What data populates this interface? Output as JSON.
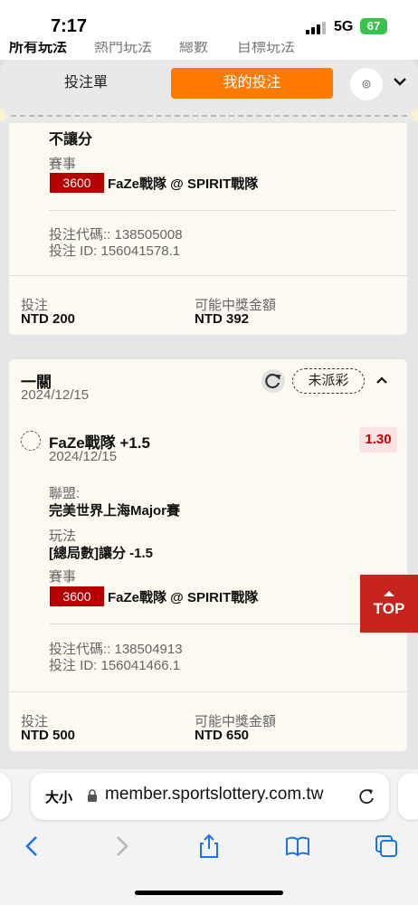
{
  "status_bar": {
    "time": "7:17",
    "network": "5G",
    "battery": "67"
  },
  "top_tabs": [
    "所有玩法",
    "熱門玩法",
    "總數",
    "目標玩法"
  ],
  "slip_header": {
    "tab_slip": "投注單",
    "tab_my_bets": "我的投注"
  },
  "bet1": {
    "play_value": "不讓分",
    "event_label": "賽事",
    "match_code": "3600",
    "match_name": "FaZe戰隊 @ SPIRIT戰隊",
    "bet_code": "投注代碼:: 138505008",
    "bet_id": "投注 ID: 156041578.1",
    "stake_label": "投注",
    "stake_value": "NTD 200",
    "payout_label": "可能中獎金額",
    "payout_value": "NTD 392"
  },
  "bet2": {
    "type": "一關",
    "date": "2024/12/15",
    "status": "未派彩",
    "selection": "FaZe戰隊 +1.5",
    "selection_date": "2024/12/15",
    "odds": "1.30",
    "league_label": "聯盟:",
    "league_value": "完美世界上海Major賽",
    "play_label": "玩法",
    "play_value": "[總局數]讓分 -1.5",
    "event_label": "賽事",
    "match_code": "3600",
    "match_name": "FaZe戰隊 @ SPIRIT戰隊",
    "bet_code": "投注代碼:: 138504913",
    "bet_id": "投注 ID: 156041466.1",
    "stake_label": "投注",
    "stake_value": "NTD 500",
    "payout_label": "可能中獎金額",
    "payout_value": "NTD 650"
  },
  "top_button": "TOP",
  "browser": {
    "text_size": "大小",
    "url": "member.sportslottery.com.tw"
  },
  "icons": [
    "signal-icon",
    "battery-icon",
    "settings-icon",
    "chevron-down-icon",
    "refresh-icon",
    "chevron-up-icon",
    "lock-icon",
    "reload-icon",
    "back-icon",
    "forward-icon",
    "share-icon",
    "bookmarks-icon",
    "tabs-icon"
  ]
}
